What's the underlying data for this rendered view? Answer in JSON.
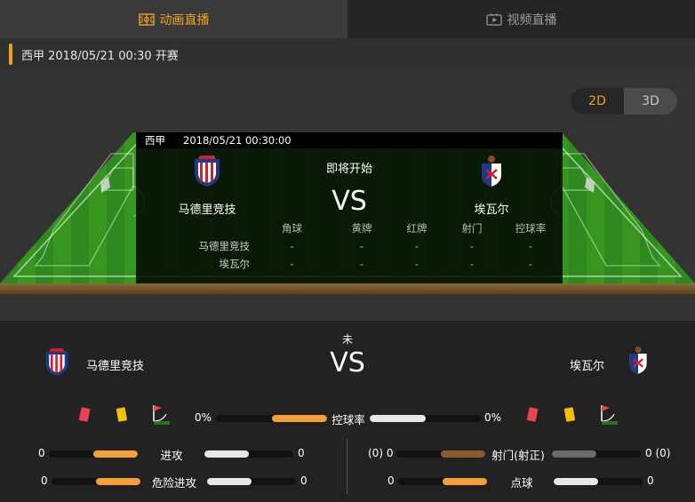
{
  "tabs": {
    "animation_label": "动画直播",
    "video_label": "视频直播"
  },
  "infobar": {
    "text": "西甲 2018/05/21 00:30 开赛"
  },
  "view_toggle": {
    "two_d": "2D",
    "three_d": "3D"
  },
  "overlay": {
    "league": "西甲",
    "datetime": "2018/05/21 00:30:00",
    "status": "即将开始",
    "vs": "VS",
    "home_name": "马德里竞技",
    "away_name": "埃瓦尔",
    "columns": [
      "角球",
      "黄牌",
      "红牌",
      "射门",
      "控球率"
    ],
    "rows": [
      {
        "team": "马德里竞技",
        "values": [
          "-",
          "-",
          "-",
          "-",
          "-"
        ]
      },
      {
        "team": "埃瓦尔",
        "values": [
          "-",
          "-",
          "-",
          "-",
          "-"
        ]
      }
    ]
  },
  "match": {
    "status": "未",
    "vs": "VS",
    "home_name": "马德里竞技",
    "away_name": "埃瓦尔"
  },
  "possession": {
    "label": "控球率",
    "home_pct": "0%",
    "away_pct": "0%",
    "home_fill": 0.5,
    "away_fill": 0.5
  },
  "stats_left": [
    {
      "label": "进攻",
      "home": "0",
      "away": "0",
      "home_fill": 0.5,
      "away_fill": 0.5
    },
    {
      "label": "危险进攻",
      "home": "0",
      "away": "0",
      "home_fill": 0.5,
      "away_fill": 0.5
    }
  ],
  "stats_right": [
    {
      "label": "射门(射正)",
      "home": "(0) 0",
      "away": "0 (0)",
      "home_fill": 0.5,
      "away_fill": 0.5
    },
    {
      "label": "点球",
      "home": "0",
      "away": "0",
      "home_fill": 0.5,
      "away_fill": 0.5
    }
  ],
  "colors": {
    "accent": "#f0a020",
    "home_bar": "#f5a039",
    "away_bar": "#e8e8e8",
    "shots_home_bar": "#8a5a2a",
    "shots_away_bar": "#6a6a6a",
    "pitch_green": "#2f8a1f"
  },
  "icons": {
    "animation_tab": "soccer-field-icon",
    "video_tab": "tv-play-icon",
    "red_card": "red-card-icon",
    "yellow_card": "yellow-card-icon",
    "corner": "corner-flag-icon"
  }
}
